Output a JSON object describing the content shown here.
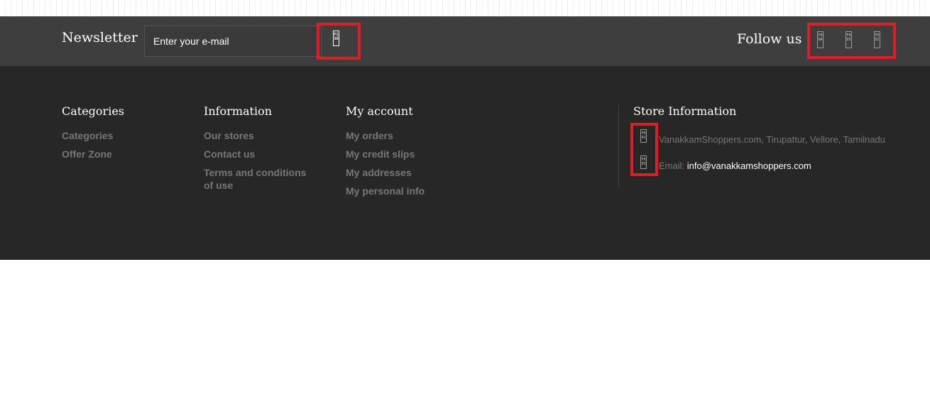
{
  "newsletter": {
    "title": "Newsletter",
    "placeholder": "Enter your e-mail",
    "submit_icon": {
      "name": "arrow-right-icon",
      "code": "F138"
    }
  },
  "follow": {
    "title": "Follow us",
    "icons": [
      {
        "name": "facebook-icon",
        "code": "F09A"
      },
      {
        "name": "twitter-icon",
        "code": "F0D5"
      },
      {
        "name": "google-plus-icon",
        "code": "F0D2"
      }
    ]
  },
  "columns": {
    "categories": {
      "title": "Categories",
      "links": [
        "Categories",
        "Offer Zone"
      ]
    },
    "information": {
      "title": "Information",
      "links": [
        "Our stores",
        "Contact us",
        "Terms and conditions of use"
      ]
    },
    "account": {
      "title": "My account",
      "links": [
        "My orders",
        "My credit slips",
        "My addresses",
        "My personal info"
      ]
    }
  },
  "store": {
    "title": "Store Information",
    "address": "VanakkamShoppers.com, Tirupattur, Vellore, Tamilnadu",
    "address_icon": {
      "name": "map-marker-icon",
      "code": "F041"
    },
    "email_label": "Email: ",
    "email": "info@vanakkamshoppers.com",
    "email_icon": {
      "name": "envelope-icon",
      "code": "F003"
    }
  },
  "colors": {
    "newsletter_bg": "#3e3e3e",
    "footer_bg": "#272727",
    "highlight": "#e11c24",
    "link": "#777777"
  }
}
